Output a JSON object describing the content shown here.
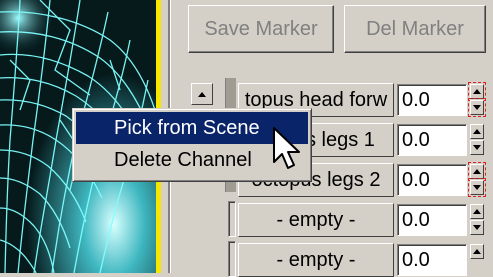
{
  "toolbar": {
    "save_marker_label": "Save Marker",
    "del_marker_label": "Del Marker"
  },
  "channels": [
    {
      "name": "topus head forw",
      "value": "0.0",
      "keyed": true
    },
    {
      "name": "ctopus legs 1",
      "value": "0.0",
      "keyed": false
    },
    {
      "name": "octopus legs 2",
      "value": "0.0",
      "keyed": true
    },
    {
      "name": "- empty -",
      "value": "0.0",
      "keyed": false
    },
    {
      "name": "- empty -",
      "value": "0.0",
      "keyed": false
    }
  ],
  "context_menu": {
    "items": [
      {
        "label": "Pick from Scene",
        "highlighted": true
      },
      {
        "label": "Delete Channel",
        "highlighted": false
      }
    ]
  },
  "colors": {
    "viewport_border": "#f7e600",
    "wireframe": "#7fffff",
    "menu_highlight": "#0a246a",
    "key_marker": "#e02020"
  },
  "icons": {
    "scroll": "triangle-up-icon",
    "cursor": "mouse-pointer-icon"
  }
}
